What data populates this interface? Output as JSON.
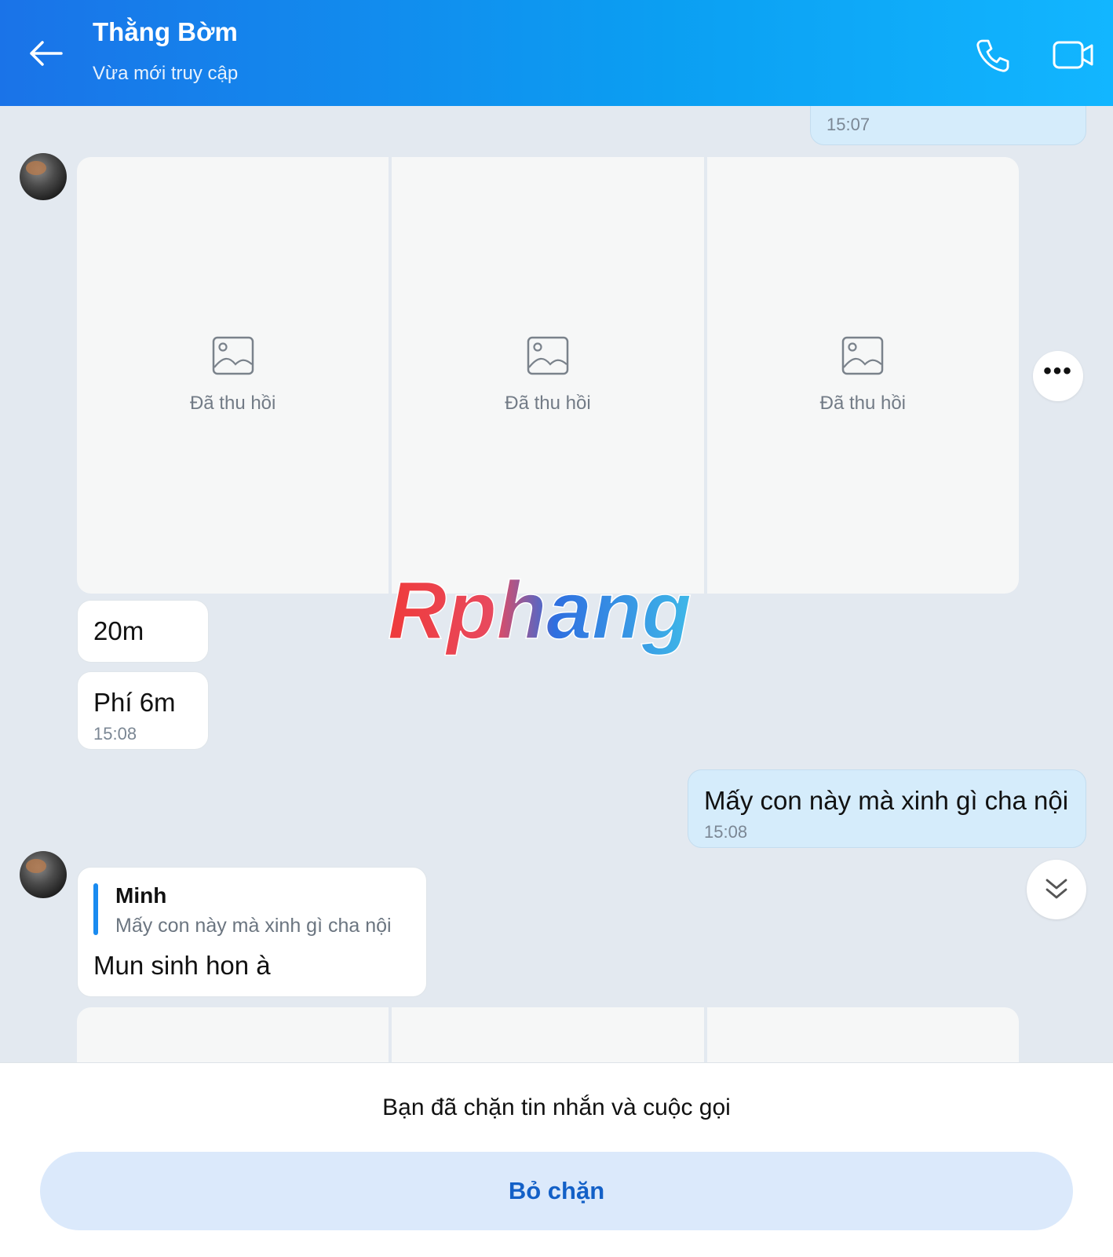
{
  "header": {
    "title": "Thằng Bờm",
    "subtitle": "Vừa mới truy cập",
    "gradient_start": "#1a73e8",
    "gradient_end": "#12b6ff"
  },
  "messages": {
    "top_time": "15:07",
    "revoked_grid": [
      {
        "label": "Đã thu hồi"
      },
      {
        "label": "Đã thu hồi"
      },
      {
        "label": "Đã thu hồi"
      }
    ],
    "msg_20m": "20m",
    "msg_phi": "Phí 6m",
    "msg_phi_time": "15:08",
    "mine_text": "Mấy con này mà xinh gì cha nội",
    "mine_time": "15:08",
    "reply": {
      "quoted_name": "Minh",
      "quoted_text": "Mấy con này mà xinh gì cha nội",
      "text": "Mun sinh hon à"
    }
  },
  "watermark": "Rphang",
  "footer": {
    "blocked_text": "Bạn đã chặn tin nhắn và cuộc gọi",
    "unblock_label": "Bỏ chặn"
  },
  "icons": {
    "back": "arrow-left-icon",
    "call": "phone-icon",
    "video": "video-camera-icon",
    "image": "image-placeholder-icon",
    "more": "more-horizontal-icon",
    "scroll": "double-chevron-down-icon"
  }
}
